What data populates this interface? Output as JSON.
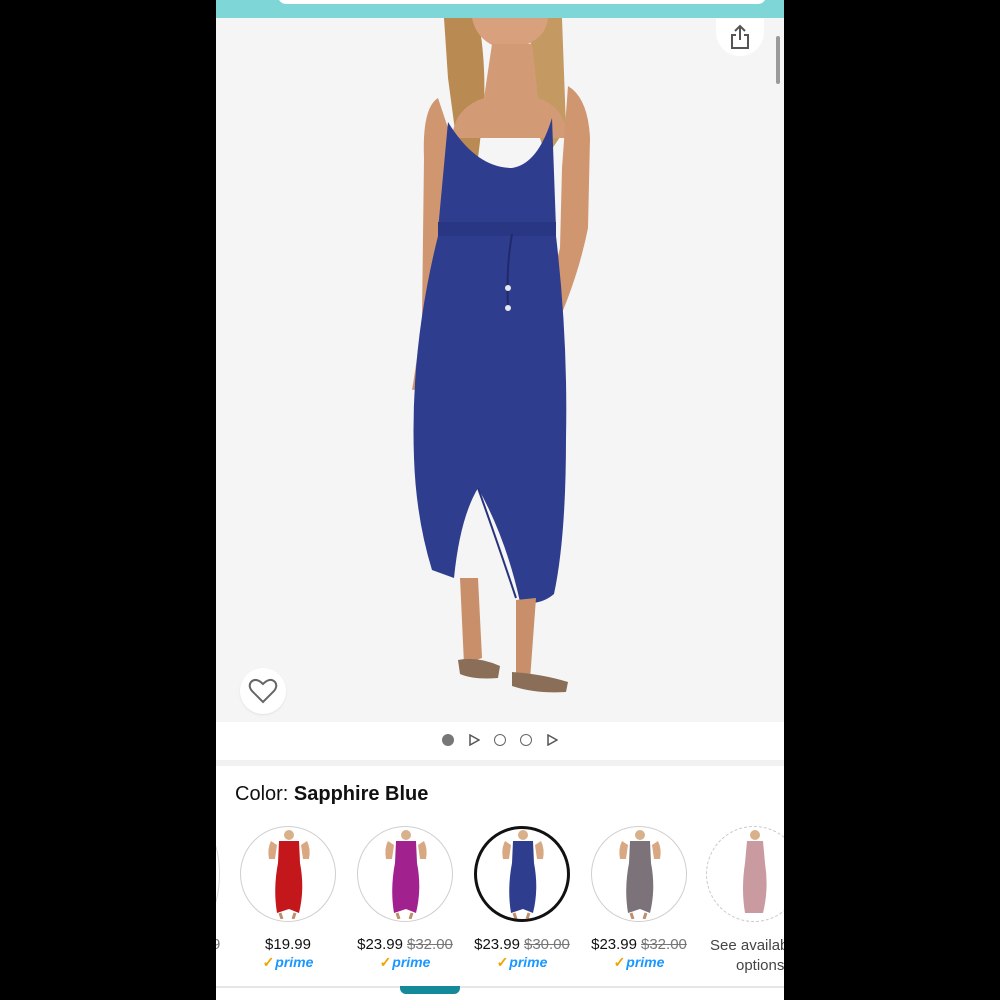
{
  "colors": {
    "header_teal": "#7fd6d6",
    "selected_dress": "#2f3d8f",
    "prime_blue": "#1a98ff",
    "prime_check": "#f0a300"
  },
  "icons": {
    "share": "share-icon",
    "wishlist": "heart-icon",
    "video": "play-icon"
  },
  "gallery": {
    "indicators": [
      "dot",
      "play",
      "dot",
      "dot",
      "play"
    ],
    "active_index": 0
  },
  "color_selector": {
    "label": "Color: ",
    "selected_name": "Sapphire Blue",
    "left_partial_price": "9",
    "options": [
      {
        "swatch_color": "#c3171c",
        "price": "$19.99",
        "old_price": "",
        "prime": "prime"
      },
      {
        "swatch_color": "#a1218f",
        "price": "$23.99",
        "old_price": "$32.00",
        "prime": "prime"
      },
      {
        "swatch_color": "#2f3d8f",
        "price": "$23.99",
        "old_price": "$30.00",
        "prime": "prime"
      },
      {
        "swatch_color": "#7c7279",
        "price": "$23.99",
        "old_price": "$32.00",
        "prime": "prime"
      }
    ],
    "more_option": {
      "swatch_color": "#c99aa0",
      "line1": "See availab",
      "line2": "options"
    }
  }
}
